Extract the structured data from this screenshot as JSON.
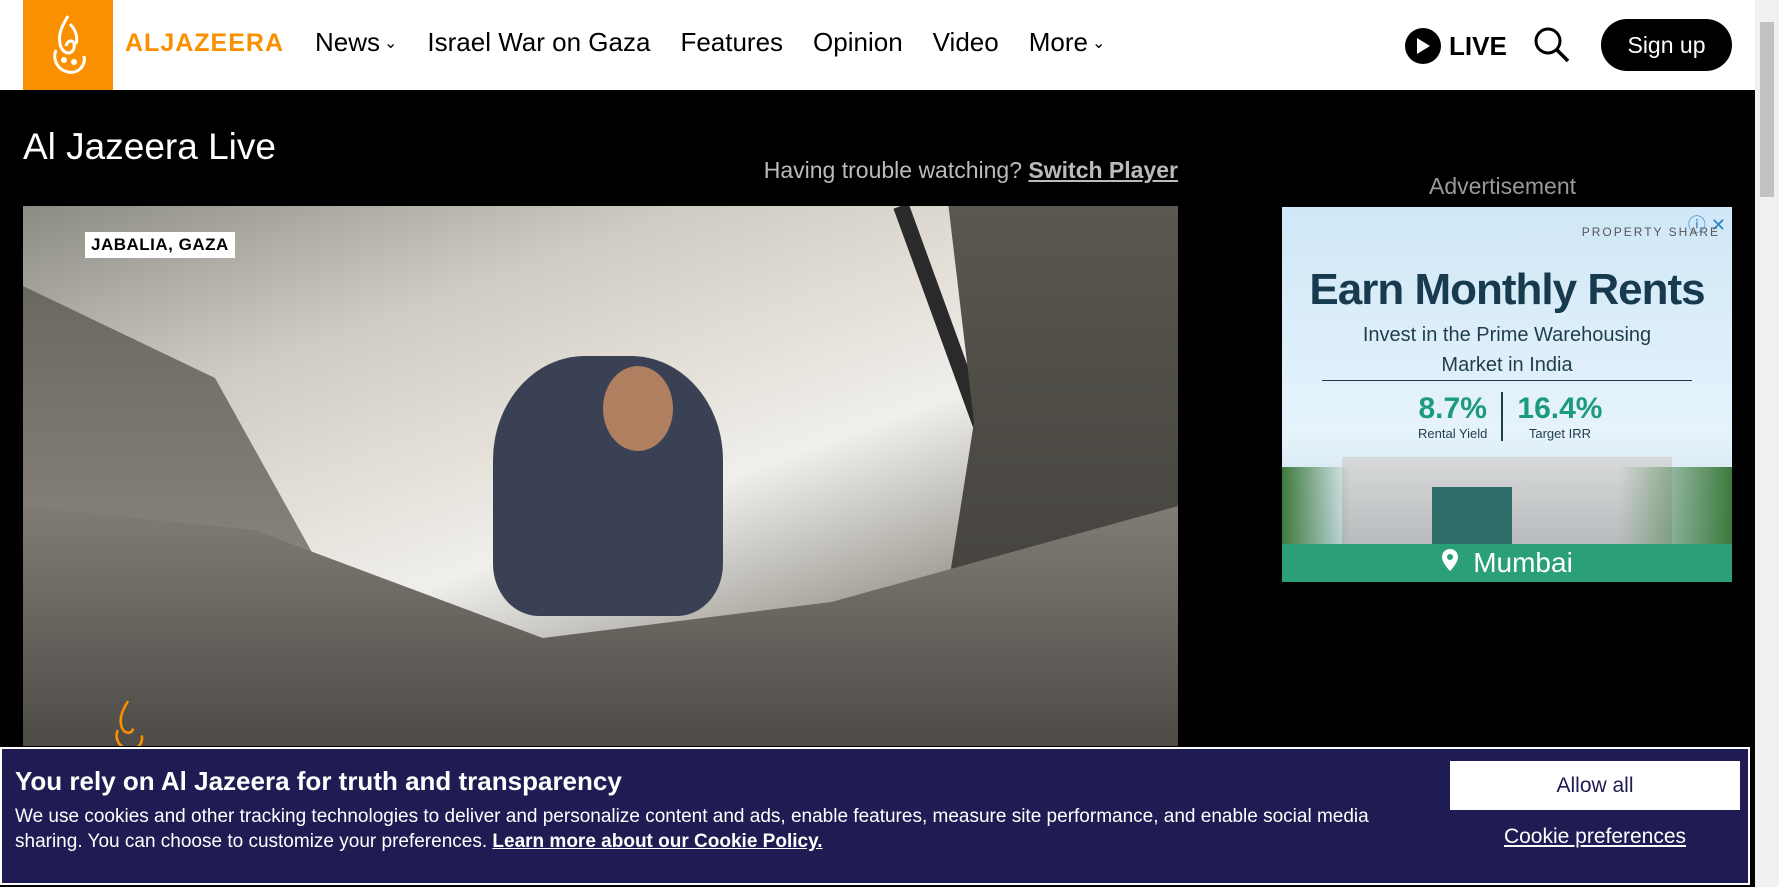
{
  "header": {
    "logo_text": "ALJAZEERA",
    "nav": [
      {
        "label": "News",
        "has_dropdown": true
      },
      {
        "label": "Israel War on Gaza",
        "has_dropdown": false
      },
      {
        "label": "Features",
        "has_dropdown": false
      },
      {
        "label": "Opinion",
        "has_dropdown": false
      },
      {
        "label": "Video",
        "has_dropdown": false
      },
      {
        "label": "More",
        "has_dropdown": true
      }
    ],
    "live_label": "LIVE",
    "signup_label": "Sign up",
    "brand_color": "#fa9000"
  },
  "main": {
    "title": "Al Jazeera Live",
    "trouble_text": "Having trouble watching?",
    "switch_player_label": "Switch Player",
    "video": {
      "location_label": "JABALIA, GAZA"
    }
  },
  "ad": {
    "label": "Advertisement",
    "brand": "PROPERTY SHARE",
    "headline": "Earn Monthly Rents",
    "subline1": "Invest in the Prime Warehousing",
    "subline2": "Market in India",
    "stat1_value": "8.7%",
    "stat1_label": "Rental Yield",
    "stat2_value": "16.4%",
    "stat2_label": "Target IRR",
    "city": "Mumbai"
  },
  "cookie": {
    "title": "You rely on Al Jazeera for truth and transparency",
    "text": "We use cookies and other tracking technologies to deliver and personalize content and ads, enable features, measure site performance, and enable social media sharing. You can choose to customize your preferences.",
    "link_label": "Learn more about our Cookie Policy.",
    "allow_label": "Allow all",
    "prefs_label": "Cookie preferences"
  }
}
